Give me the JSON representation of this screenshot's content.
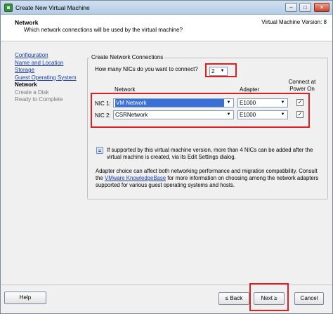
{
  "window": {
    "title": "Create New Virtual Machine",
    "controls": {
      "minimize": "–",
      "maximize": "□",
      "close": "✕"
    }
  },
  "header": {
    "title": "Network",
    "subtitle": "Which network connections will be used by the virtual machine?",
    "version": "Virtual Machine Version: 8"
  },
  "nav": {
    "items": [
      {
        "label": "Configuration",
        "state": "link"
      },
      {
        "label": "Name and Location",
        "state": "link"
      },
      {
        "label": "Storage",
        "state": "link"
      },
      {
        "label": "Guest Operating System",
        "state": "link"
      },
      {
        "label": "Network",
        "state": "current"
      },
      {
        "label": "Create a Disk",
        "state": "disabled"
      },
      {
        "label": "Ready to Complete",
        "state": "disabled"
      }
    ]
  },
  "main": {
    "group_title": "Create Network Connections",
    "nic_count_question": "How many NICs do you want to connect?",
    "nic_count_value": "2",
    "columns": {
      "network": "Network",
      "adapter": "Adapter",
      "connect": "Connect at Power On"
    },
    "nics": [
      {
        "label": "NIC 1:",
        "network": "VM Network",
        "adapter": "E1000",
        "connected": true,
        "selected": true
      },
      {
        "label": "NIC 2:",
        "network": "CSRNetwork",
        "adapter": "E1000",
        "connected": true,
        "selected": false
      }
    ],
    "info_text": "If supported by this virtual machine version, more than 4 NICs can be added after the virtual machine is created, via its Edit Settings dialog.",
    "adapter_text_before": "Adapter choice can affect both networking performance and migration compatibility. Consult the ",
    "adapter_link": "VMware KnowledgeBase",
    "adapter_text_after": " for more information on choosing among the network adapters supported for various guest operating systems and hosts."
  },
  "footer": {
    "help": "Help",
    "back": "≤ Back",
    "next": "Next ≥",
    "cancel": "Cancel"
  },
  "colors": {
    "highlight_box": "#e02020",
    "link": "#1a3fa6",
    "selection": "#3a6fd8"
  }
}
